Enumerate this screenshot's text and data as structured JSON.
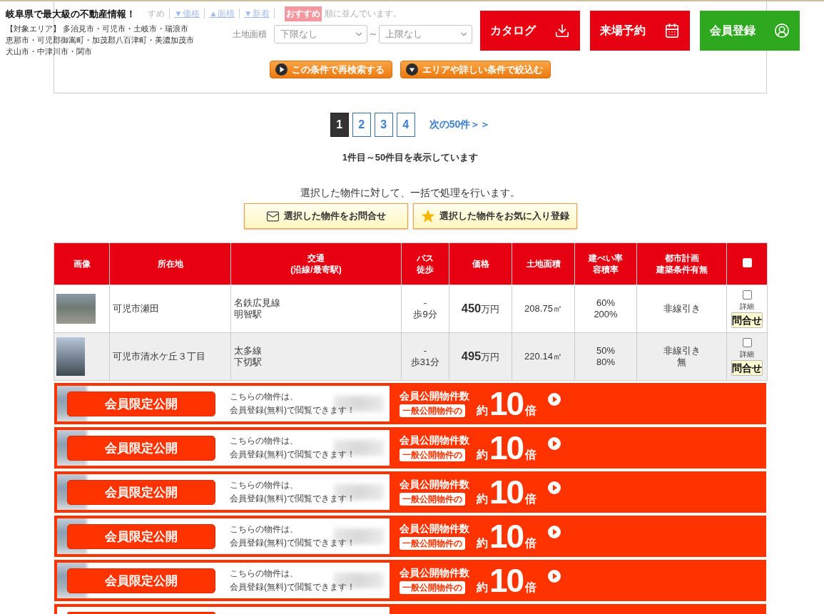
{
  "header": {
    "title": "岐阜県で最大級の不動産情報！",
    "area_lines": [
      "【対象エリア】 多治見市・可児市・土岐市・瑞浪市",
      "恵那市・可児郡御嵩町・加茂郡八百津町・美濃加茂市",
      "犬山市・中津川市・関市"
    ],
    "buttons": [
      {
        "label": "カタログ",
        "kind": "catalog"
      },
      {
        "label": "来場予約",
        "kind": "visit"
      },
      {
        "label": "会員登録",
        "kind": "member"
      }
    ]
  },
  "search_form": {
    "sort_links": [
      {
        "label": "すめ",
        "kind": "plain"
      },
      {
        "label": "▼価格",
        "kind": "link"
      },
      {
        "label": "▲面積",
        "kind": "link"
      },
      {
        "label": "▼新着",
        "kind": "link"
      }
    ],
    "sort_badge": "おすすめ",
    "sort_suffix": "順に並んでいます。",
    "filter": {
      "label": "土地面積",
      "min_value": "下限なし",
      "separator": "～",
      "max_value": "上限なし"
    },
    "buttons": [
      {
        "label": "この条件で再検索する",
        "kind": "search"
      },
      {
        "label": "エリアや詳しい条件で絞込む",
        "kind": "refine"
      }
    ]
  },
  "pagination": {
    "pages": [
      {
        "label": "1",
        "selected": true
      },
      {
        "label": "2",
        "selected": false
      },
      {
        "label": "3",
        "selected": false
      },
      {
        "label": "4",
        "selected": false
      }
    ],
    "next": "次の50件＞＞"
  },
  "range_text": "1件目～50件目を表示しています",
  "bulk": {
    "text": "選択した物件に対して、一括で処理を行います。",
    "buttons": [
      {
        "label": "選択した物件をお問合せ",
        "kind": "mail"
      },
      {
        "label": "選択した物件をお気に入り登録",
        "kind": "favorite"
      }
    ]
  },
  "table": {
    "columns": [
      [
        "画像"
      ],
      [
        "所在地"
      ],
      [
        "交通",
        "(沿線/最寄駅)"
      ],
      [
        "バス",
        "徒歩"
      ],
      [
        "価格"
      ],
      [
        "土地面積"
      ],
      [
        "建ぺい率",
        "容積率"
      ],
      [
        "都市計画",
        "建築条件有無"
      ]
    ],
    "select_all_checked": false,
    "rows": [
      {
        "kind": "landscape",
        "location": "可児市瀬田",
        "transit": [
          "名鉄広見線",
          "明智駅"
        ],
        "bus_walk": [
          "-",
          "歩9分"
        ],
        "price": "**450**万円",
        "land_area": "208.75㎡",
        "ratios": [
          "60%",
          "200%"
        ],
        "planning": [
          "非線引き"
        ],
        "checked": false,
        "detail": "詳細",
        "inquiry": "問合せ"
      },
      {
        "kind": "portrait",
        "location": "可児市清水ケ丘３丁目",
        "transit": [
          "太多線",
          "下切駅"
        ],
        "bus_walk": [
          "-",
          "歩31分"
        ],
        "price": "**495**万円",
        "land_area": "220.14㎡",
        "ratios": [
          "50%",
          "80%"
        ],
        "planning": [
          "非線引き",
          "無"
        ],
        "checked": false,
        "detail": "詳細",
        "inquiry": "問合せ"
      }
    ]
  },
  "banners": [
    {
      "kind": "full",
      "button": "会員限定公開",
      "message_lines": [
        "こちらの物件は、",
        "会員登録(無料)で閲覧できます！"
      ],
      "count_label": "会員公開物件数",
      "compare_badge": "一般公開物件の",
      "prefix": "約",
      "multiplier": "10",
      "suffix": "倍"
    },
    {
      "kind": "full",
      "button": "会員限定公開",
      "message_lines": [
        "こちらの物件は、",
        "会員登録(無料)で閲覧できます！"
      ],
      "count_label": "会員公開物件数",
      "compare_badge": "一般公開物件の",
      "prefix": "約",
      "multiplier": "10",
      "suffix": "倍"
    },
    {
      "kind": "full",
      "button": "会員限定公開",
      "message_lines": [
        "こちらの物件は、",
        "会員登録(無料)で閲覧できます！"
      ],
      "count_label": "会員公開物件数",
      "compare_badge": "一般公開物件の",
      "prefix": "約",
      "multiplier": "10",
      "suffix": "倍"
    },
    {
      "kind": "full",
      "button": "会員限定公開",
      "message_lines": [
        "こちらの物件は、",
        "会員登録(無料)で閲覧できます！"
      ],
      "count_label": "会員公開物件数",
      "compare_badge": "一般公開物件の",
      "prefix": "約",
      "multiplier": "10",
      "suffix": "倍"
    },
    {
      "kind": "full",
      "button": "会員限定公開",
      "message_lines": [
        "こちらの物件は、",
        "会員登録(無料)で閲覧できます！"
      ],
      "count_label": "会員公開物件数",
      "compare_badge": "一般公開物件の",
      "prefix": "約",
      "multiplier": "10",
      "suffix": "倍"
    },
    {
      "kind": "cut"
    }
  ]
}
